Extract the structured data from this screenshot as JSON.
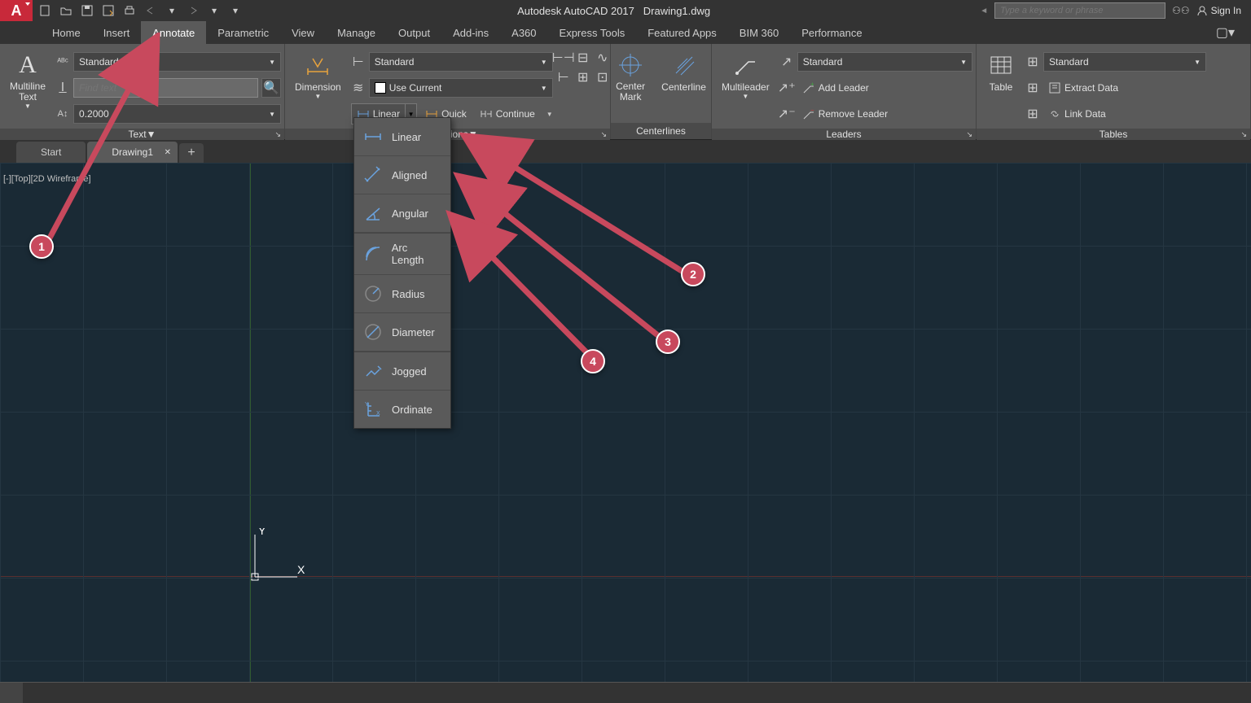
{
  "title": {
    "app": "Autodesk AutoCAD 2017",
    "file": "Drawing1.dwg"
  },
  "search_placeholder": "Type a keyword or phrase",
  "signin": "Sign In",
  "tabs": [
    "Home",
    "Insert",
    "Annotate",
    "Parametric",
    "View",
    "Manage",
    "Output",
    "Add-ins",
    "A360",
    "Express Tools",
    "Featured Apps",
    "BIM 360",
    "Performance"
  ],
  "active_tab": "Annotate",
  "panels": {
    "text": {
      "title": "Text",
      "big": "Multiline\nText",
      "style": "Standard",
      "find_placeholder": "Find text",
      "height": "0.2000"
    },
    "dimensions": {
      "title": "Dimensions",
      "big": "Dimension",
      "dimstyle": "Standard",
      "layer": "Use Current",
      "linear": "Linear",
      "quick": "Quick",
      "continue": "Continue"
    },
    "centerlines": {
      "title": "Centerlines",
      "centermark": "Center\nMark",
      "centerline": "Centerline"
    },
    "leaders": {
      "title": "Leaders",
      "big": "Multileader",
      "style": "Standard",
      "add": "Add Leader",
      "remove": "Remove Leader"
    },
    "tables": {
      "title": "Tables",
      "big": "Table",
      "style": "Standard",
      "extract": "Extract Data",
      "link": "Link Data"
    }
  },
  "flyout": {
    "items": [
      "Linear",
      "Aligned",
      "Angular",
      "Arc Length",
      "Radius",
      "Diameter",
      "Jogged",
      "Ordinate"
    ]
  },
  "filetabs": {
    "start": "Start",
    "drawing": "Drawing1"
  },
  "viewlabel": "[-][Top][2D Wireframe]",
  "ucs": {
    "x": "X",
    "y": "Y"
  },
  "annotations": {
    "1": "1",
    "2": "2",
    "3": "3",
    "4": "4"
  }
}
